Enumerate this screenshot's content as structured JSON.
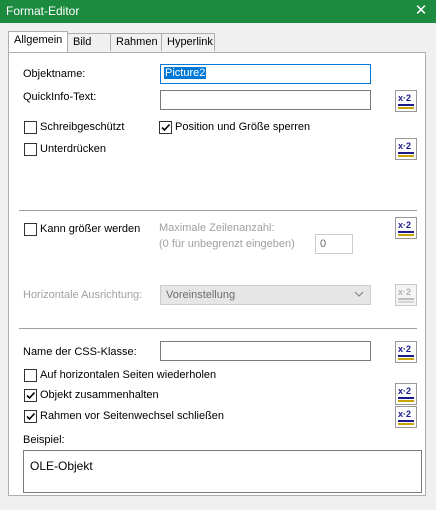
{
  "window": {
    "title": "Format-Editor",
    "close_label": "✕"
  },
  "tabs": [
    {
      "label": "Allgemein",
      "active": true
    },
    {
      "label": "Bild",
      "active": false
    },
    {
      "label": "Rahmen",
      "active": false
    },
    {
      "label": "Hyperlink",
      "active": false
    }
  ],
  "general": {
    "object_name_label": "Objektname:",
    "object_name_value": "Picture2",
    "quickinfo_label": "QuickInfo-Text:",
    "quickinfo_value": "",
    "readonly_label": "Schreibgeschützt",
    "readonly_checked": false,
    "lock_label": "Position und Größe sperren",
    "lock_checked": true,
    "suppress_label": "Unterdrücken",
    "suppress_checked": false
  },
  "grow": {
    "can_grow_label": "Kann größer werden",
    "can_grow_checked": false,
    "max_lines_label": "Maximale Zeilenanzahl:",
    "max_lines_hint": "(0 für unbegrenzt eingeben)",
    "max_lines_value": "0"
  },
  "alignment": {
    "label": "Horizontale Ausrichtung:",
    "value": "Voreinstellung"
  },
  "css": {
    "class_label": "Name der CSS-Klasse:",
    "class_value": "",
    "repeat_label": "Auf horizontalen Seiten wiederholen",
    "repeat_checked": false,
    "keep_together_label": "Objekt zusammenhalten",
    "keep_together_checked": true,
    "close_border_label": "Rahmen vor Seitenwechsel schließen",
    "close_border_checked": true
  },
  "example": {
    "label": "Beispiel:",
    "text": "OLE-Objekt"
  },
  "colors": {
    "titlebar": "#1c8a3f",
    "accent": "#0078d7"
  }
}
